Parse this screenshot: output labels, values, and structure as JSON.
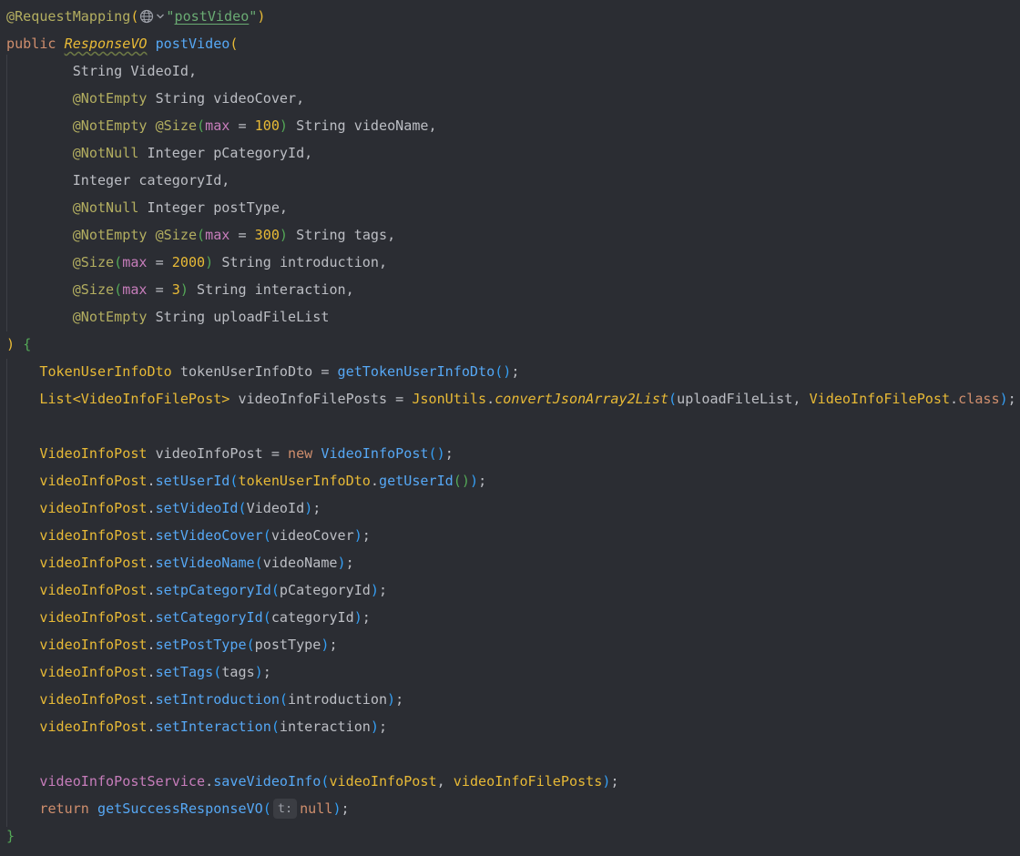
{
  "editor": {
    "language": "Java",
    "annotation_mapping": {
      "name": "@RequestMapping",
      "value": "\"postVideo\""
    },
    "signature": {
      "modifier": "public",
      "return_type": "ResponseVO",
      "method_name": "postVideo"
    },
    "params": [
      {
        "annotations": [],
        "type": "String",
        "name": "VideoId,"
      },
      {
        "annotations": [
          "@NotEmpty"
        ],
        "type": "String",
        "name": "videoCover,"
      },
      {
        "annotations": [
          "@NotEmpty",
          "@Size"
        ],
        "size_arg": "max",
        "size_val": "100",
        "type": "String",
        "name": "videoName,"
      },
      {
        "annotations": [
          "@NotNull"
        ],
        "type": "Integer",
        "name": "pCategoryId,"
      },
      {
        "annotations": [],
        "type": "Integer",
        "name": "categoryId,"
      },
      {
        "annotations": [
          "@NotNull"
        ],
        "type": "Integer",
        "name": "postType,"
      },
      {
        "annotations": [
          "@NotEmpty",
          "@Size"
        ],
        "size_arg": "max",
        "size_val": "300",
        "type": "String",
        "name": "tags,"
      },
      {
        "annotations": [
          "@Size"
        ],
        "size_arg": "max",
        "size_val": "2000",
        "type": "String",
        "name": "introduction,"
      },
      {
        "annotations": [
          "@Size"
        ],
        "size_arg": "max",
        "size_val": "3",
        "type": "String",
        "name": "interaction,"
      },
      {
        "annotations": [
          "@NotEmpty"
        ],
        "type": "String",
        "name": "uploadFileList"
      }
    ],
    "body": {
      "token_line": {
        "type": "TokenUserInfoDto",
        "var": "tokenUserInfoDto",
        "call": "getTokenUserInfoDto"
      },
      "list_line": {
        "type": "List<VideoInfoFilePost>",
        "var": "videoInfoFilePosts",
        "cls": "JsonUtils",
        "call": "convertJsonArray2List",
        "arg1": "uploadFileList",
        "arg2cls": "VideoInfoFilePost",
        "arg2kw": "class"
      },
      "new_line": {
        "type": "VideoInfoPost",
        "var": "videoInfoPost",
        "kw": "new",
        "ctor": "VideoInfoPost"
      },
      "setter_obj": "videoInfoPost",
      "set_user": {
        "setter": "setUserId",
        "obj": "tokenUserInfoDto",
        "getter": "getUserId"
      },
      "setters": [
        {
          "setter": "setVideoId",
          "arg": "VideoId"
        },
        {
          "setter": "setVideoCover",
          "arg": "videoCover"
        },
        {
          "setter": "setVideoName",
          "arg": "videoName"
        },
        {
          "setter": "setpCategoryId",
          "arg": "pCategoryId"
        },
        {
          "setter": "setCategoryId",
          "arg": "categoryId"
        },
        {
          "setter": "setPostType",
          "arg": "postType"
        },
        {
          "setter": "setTags",
          "arg": "tags"
        },
        {
          "setter": "setIntroduction",
          "arg": "introduction"
        },
        {
          "setter": "setInteraction",
          "arg": "interaction"
        }
      ],
      "save_line": {
        "field": "videoInfoPostService",
        "call": "saveVideoInfo",
        "arg1": "videoInfoPost",
        "arg2": "videoInfoFilePosts"
      },
      "return_line": {
        "kw": "return",
        "call": "getSuccessResponseVO",
        "hint": "t:",
        "arg": "null"
      }
    }
  },
  "colors": {
    "background": "#2b2d33",
    "annotation": "#b3ae60",
    "keyword": "#cf8e6d",
    "string": "#6aab73",
    "number": "#2aacb8",
    "function": "#56a8f5",
    "parameter": "#b189f5",
    "field": "#c77dbb"
  },
  "icons": [
    "globe-icon",
    "chevron-down-icon"
  ]
}
